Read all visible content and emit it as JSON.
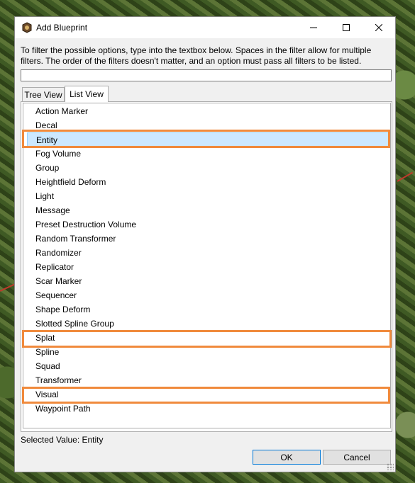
{
  "window": {
    "title": "Add Blueprint",
    "controls": {
      "minimize": "—",
      "maximize": "☐",
      "close": "✕"
    }
  },
  "instructions": "To filter the possible options, type into the textbox below. Spaces in the filter allow for multiple filters. The order of the filters doesn't matter, and an option must pass all filters to be listed.",
  "filter": {
    "value": "",
    "placeholder": ""
  },
  "tabs": [
    {
      "label": "Tree View",
      "active": false
    },
    {
      "label": "List View",
      "active": true
    }
  ],
  "list": {
    "items": [
      "Action Marker",
      "Decal",
      "Entity",
      "Fog Volume",
      "Group",
      "Heightfield Deform",
      "Light",
      "Message",
      "Preset Destruction Volume",
      "Random Transformer",
      "Randomizer",
      "Replicator",
      "Scar Marker",
      "Sequencer",
      "Shape Deform",
      "Slotted Spline Group",
      "Splat",
      "Spline",
      "Squad",
      "Transformer",
      "Visual",
      "Waypoint Path"
    ],
    "selected": "Entity",
    "highlighted": [
      "Entity",
      "Splat",
      "Visual"
    ]
  },
  "selected_value": "Selected Value: Entity",
  "buttons": {
    "ok": "OK",
    "cancel": "Cancel"
  },
  "colors": {
    "highlight": "#f08a3c",
    "selection": "#cce8ff",
    "accent": "#0078d7"
  }
}
